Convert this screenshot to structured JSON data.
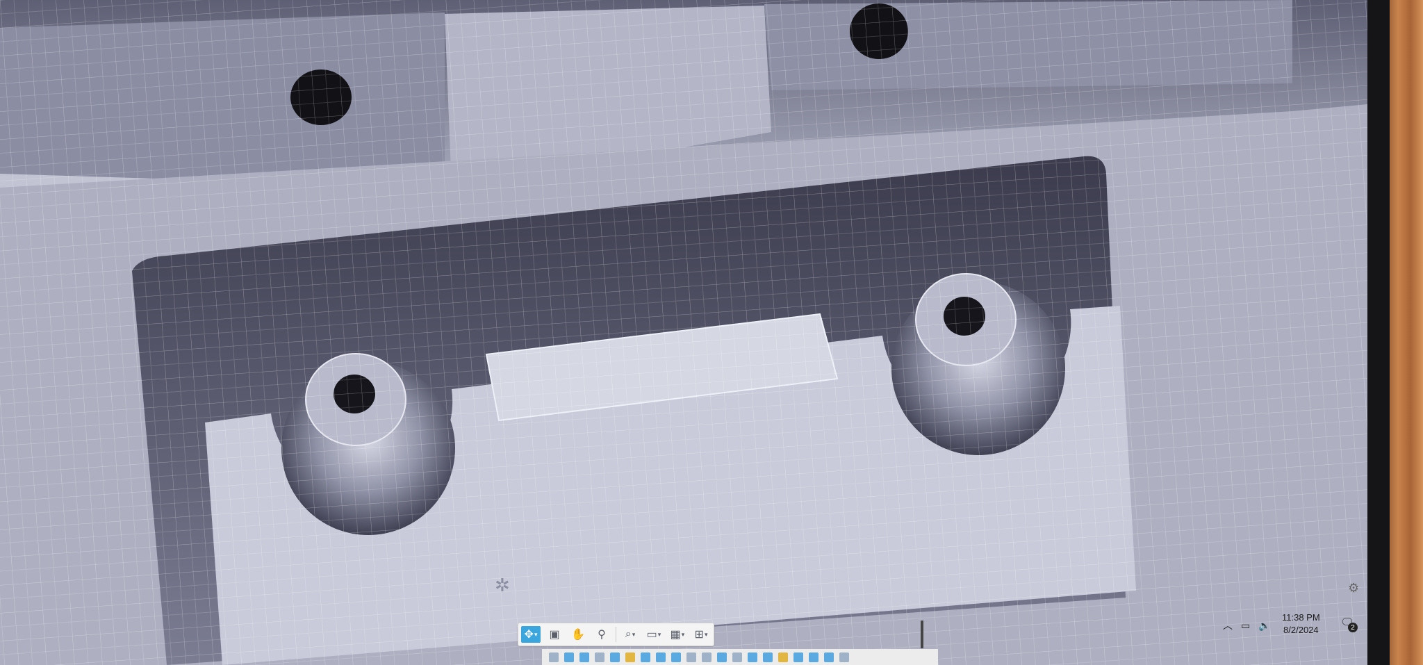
{
  "taskbar": {
    "time": "11:38 PM",
    "date": "8/2/2024",
    "notification_count": "2",
    "tray_icons": [
      "chevron-up-icon",
      "battery-icon",
      "volume-icon"
    ]
  },
  "nav_toolbar": {
    "buttons": [
      {
        "name": "orbit-button",
        "icon": "orbit-icon",
        "glyph": "✥",
        "active": true,
        "dropdown": true
      },
      {
        "name": "look-at-button",
        "icon": "look-at-icon",
        "glyph": "▣"
      },
      {
        "name": "pan-button",
        "icon": "hand-icon",
        "glyph": "✋"
      },
      {
        "name": "zoom-button",
        "icon": "zoom-icon",
        "glyph": "⚲"
      },
      {
        "name": "fit-button",
        "icon": "zoom-window-icon",
        "glyph": "🔍",
        "dropdown": true
      },
      {
        "name": "display-settings-button",
        "icon": "display-settings-icon",
        "glyph": "▭",
        "dropdown": true
      },
      {
        "name": "grid-snaps-button",
        "icon": "grid-icon",
        "glyph": "▦",
        "dropdown": true
      },
      {
        "name": "viewports-button",
        "icon": "viewports-icon",
        "glyph": "⊞",
        "dropdown": true
      }
    ]
  },
  "colors": {
    "viewport_bg": "#c3c4d3",
    "grid_line": "#ffffff",
    "model_dark": "#4b4b5e",
    "model_light": "#cfd1de",
    "accent": "#3aa6dd"
  },
  "timeline_items": [
    "#9fb2c8",
    "#5aa9e0",
    "#5aa9e0",
    "#9fb2c8",
    "#5aa9e0",
    "#e2b640",
    "#5aa9e0",
    "#5aa9e0",
    "#5aa9e0",
    "#9fb2c8",
    "#9fb2c8",
    "#5aa9e0",
    "#9fb2c8",
    "#5aa9e0",
    "#5aa9e0",
    "#e2b640",
    "#5aa9e0",
    "#5aa9e0",
    "#5aa9e0",
    "#9fb2c8"
  ]
}
